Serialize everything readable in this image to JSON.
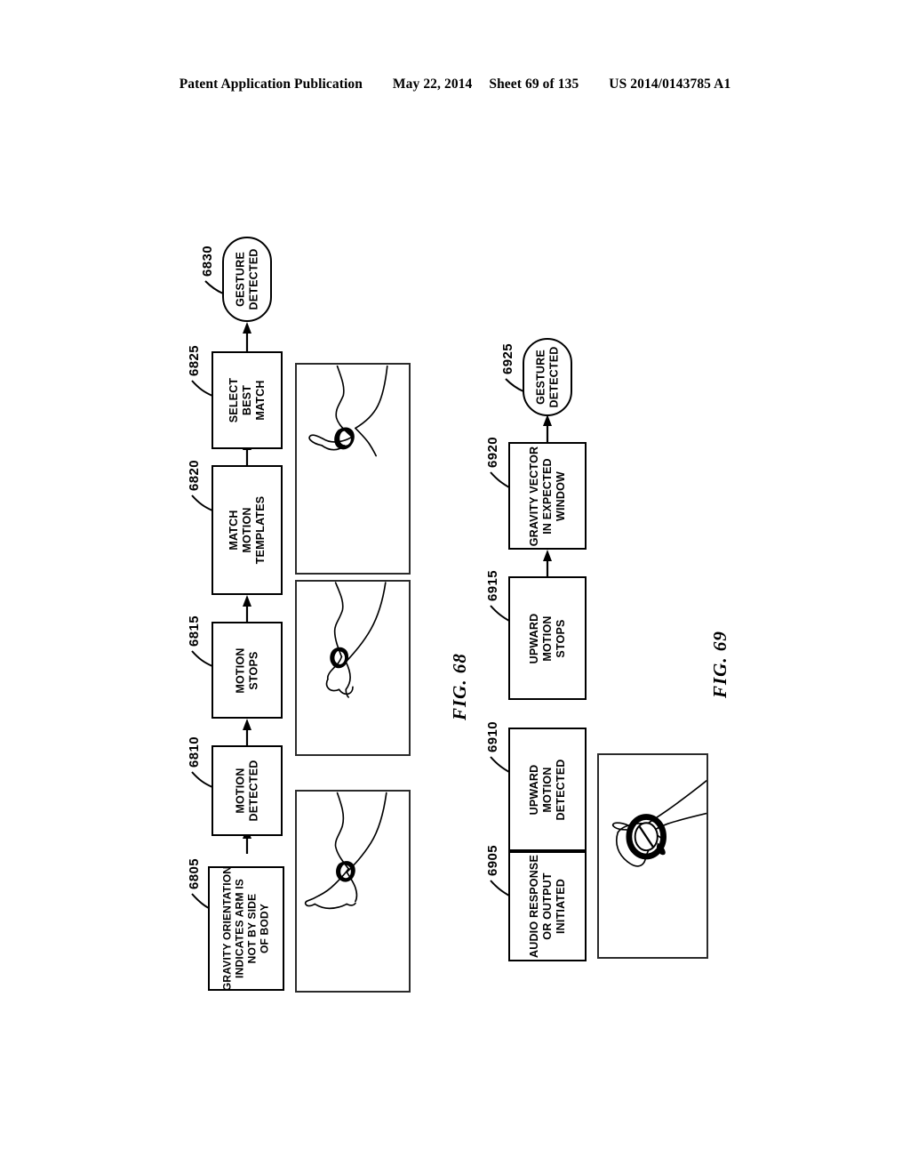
{
  "header": {
    "publication": "Patent Application Publication",
    "date": "May 22, 2014",
    "sheet": "Sheet 69 of 135",
    "patent_number": "US 2014/0143785 A1"
  },
  "figures": [
    {
      "caption": "FIG.  68",
      "nodes": [
        {
          "ref": "6805",
          "shape": "process",
          "lines": [
            "GRAVITY  ORIENTATION",
            "INDICATES  ARM  IS",
            "NOT  BY  SIDE",
            "OF  BODY"
          ]
        },
        {
          "ref": "6810",
          "shape": "process",
          "lines": [
            "MOTION",
            "DETECTED"
          ]
        },
        {
          "ref": "6815",
          "shape": "process",
          "lines": [
            "MOTION",
            "STOPS"
          ]
        },
        {
          "ref": "6820",
          "shape": "process",
          "lines": [
            "MATCH",
            "MOTION",
            "TEMPLATES"
          ]
        },
        {
          "ref": "6825",
          "shape": "process",
          "lines": [
            "SELECT",
            "BEST",
            "MATCH"
          ]
        },
        {
          "ref": "6830",
          "shape": "terminator",
          "lines": [
            "GESTURE",
            "DETECTED"
          ]
        }
      ],
      "panels": [
        {
          "name": "arm-hanging-down-pointing",
          "alt": "arm at side of body with wrist device, hand pointing down"
        },
        {
          "name": "arm-extended-downward",
          "alt": "arm extended downward with wrist device"
        },
        {
          "name": "arm-raised-bent",
          "alt": "arm bent upward with wrist device visible"
        }
      ]
    },
    {
      "caption": "FIG.  69",
      "nodes": [
        {
          "ref": "6905",
          "shape": "process",
          "lines": [
            "AUDIO  RESPONSE",
            "OR  OUTPUT",
            "INITIATED"
          ]
        },
        {
          "ref": "6910",
          "shape": "process",
          "lines": [
            "UPWARD",
            "MOTION",
            "DETECTED"
          ]
        },
        {
          "ref": "6915",
          "shape": "process",
          "lines": [
            "UPWARD",
            "MOTION",
            "STOPS"
          ]
        },
        {
          "ref": "6920",
          "shape": "process",
          "lines": [
            "GRAVITY  VECTOR",
            "IN  EXPECTED",
            "WINDOW"
          ]
        },
        {
          "ref": "6925",
          "shape": "terminator",
          "lines": [
            "GESTURE",
            "DETECTED"
          ]
        }
      ],
      "panels": [
        {
          "name": "arm-raised-to-face",
          "alt": "arm raised with watch face turned toward viewer"
        }
      ]
    }
  ],
  "colors": {
    "ink": "#000000",
    "panel_border": "#2b2b2b",
    "paper": "#ffffff"
  }
}
